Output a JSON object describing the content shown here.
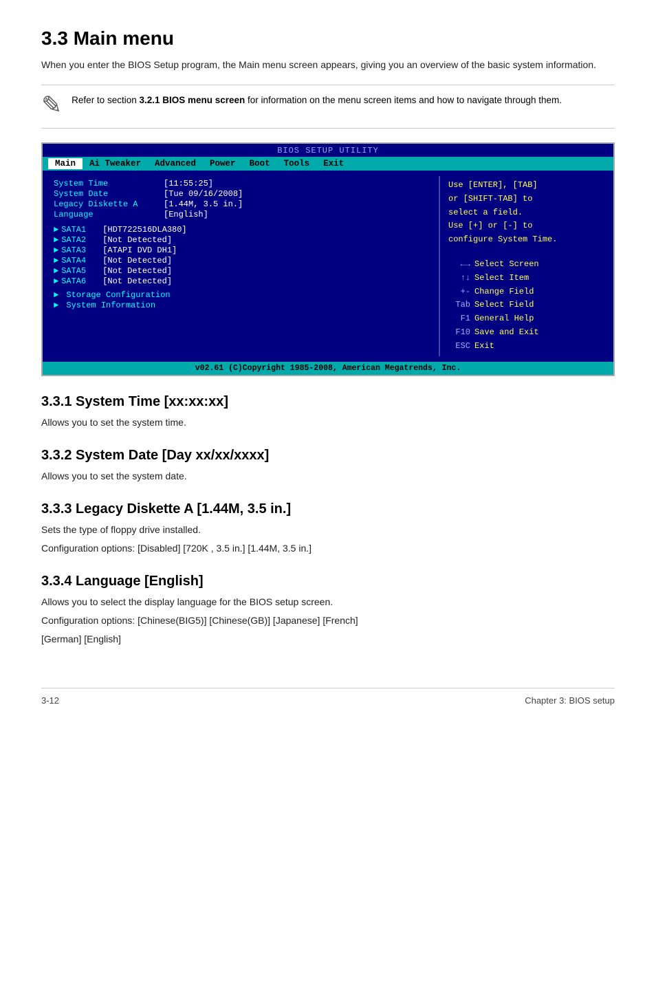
{
  "page": {
    "title": "3.3   Main menu",
    "intro": "When you enter the BIOS Setup program, the Main menu screen appears, giving you an overview of the basic system information.",
    "note": {
      "text": "Refer to section ",
      "bold": "3.2.1 BIOS menu screen",
      "text2": " for information on the menu screen items and how to navigate through them."
    }
  },
  "bios": {
    "title": "BIOS SETUP UTILITY",
    "menu_items": [
      {
        "label": "Main",
        "active": true
      },
      {
        "label": "Ai Tweaker",
        "active": false
      },
      {
        "label": "Advanced",
        "active": false
      },
      {
        "label": "Power",
        "active": false
      },
      {
        "label": "Boot",
        "active": false
      },
      {
        "label": "Tools",
        "active": false
      },
      {
        "label": "Exit",
        "active": false
      }
    ],
    "left": {
      "rows": [
        {
          "label": "System Time",
          "value": "[11:55:25]"
        },
        {
          "label": "System Date",
          "value": "[Tue 09/16/2008]"
        },
        {
          "label": "Legacy Diskette A",
          "value": "[1.44M, 3.5 in.]"
        },
        {
          "label": "Language",
          "value": "[English]"
        }
      ],
      "sata_items": [
        {
          "label": "SATA1",
          "value": "[HDT722516DLA380]"
        },
        {
          "label": "SATA2",
          "value": "[Not Detected]"
        },
        {
          "label": "SATA3",
          "value": "[ATAPI DVD DH1]"
        },
        {
          "label": "SATA4",
          "value": "[Not Detected]"
        },
        {
          "label": "SATA5",
          "value": "[Not Detected]"
        },
        {
          "label": "SATA6",
          "value": "[Not Detected]"
        }
      ],
      "submenu_items": [
        "Storage Configuration",
        "System Information"
      ]
    },
    "right": {
      "help_text": [
        "Use [ENTER], [TAB]",
        "or [SHIFT-TAB] to",
        "select a field.",
        "",
        "Use [+] or [-] to",
        "configure System Time."
      ],
      "keys": [
        {
          "sym": "←→",
          "desc": "Select Screen"
        },
        {
          "sym": "↑↓",
          "desc": "Select Item"
        },
        {
          "sym": "+-",
          "desc": "Change Field"
        },
        {
          "sym": "Tab",
          "desc": "Select Field"
        },
        {
          "sym": "F1",
          "desc": "General Help"
        },
        {
          "sym": "F10",
          "desc": "Save and Exit"
        },
        {
          "sym": "ESC",
          "desc": "Exit"
        }
      ]
    },
    "footer": "v02.61  (C)Copyright 1985-2008, American Megatrends, Inc."
  },
  "sections": [
    {
      "id": "3.3.1",
      "title": "3.3.1   System Time [xx:xx:xx]",
      "body": "Allows you to set the system time."
    },
    {
      "id": "3.3.2",
      "title": "3.3.2   System Date [Day xx/xx/xxxx]",
      "body": "Allows you to set the system date."
    },
    {
      "id": "3.3.3",
      "title": "3.3.3   Legacy Diskette A [1.44M, 3.5 in.]",
      "body": "Sets the type of floppy drive installed.\nConfiguration options: [Disabled] [720K , 3.5 in.] [1.44M, 3.5 in.]"
    },
    {
      "id": "3.3.4",
      "title": "3.3.4   Language [English]",
      "body": "Allows you to select the display language for the BIOS setup screen.\nConfiguration options: [Chinese(BIG5)] [Chinese(GB)] [Japanese] [French]\n[German] [English]"
    }
  ],
  "footer": {
    "left": "3-12",
    "right": "Chapter 3: BIOS setup"
  }
}
